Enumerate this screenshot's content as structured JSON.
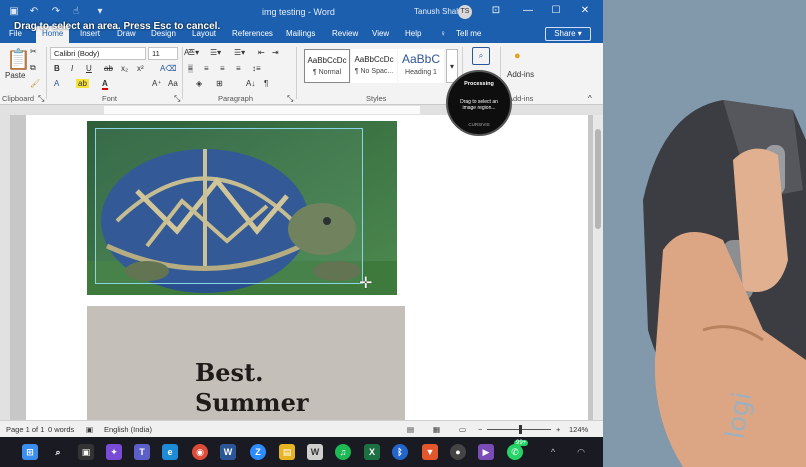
{
  "window": {
    "title": "img testing - Word",
    "user_name": "Tanush Shah",
    "avatar_initials": "TS",
    "drag_instruction": "Drag to select an area. Press Esc to cancel."
  },
  "menu": {
    "items": [
      {
        "id": "file",
        "label": "File"
      },
      {
        "id": "home",
        "label": "Home"
      },
      {
        "id": "insert",
        "label": "Insert"
      },
      {
        "id": "draw",
        "label": "Draw"
      },
      {
        "id": "design",
        "label": "Design"
      },
      {
        "id": "layout",
        "label": "Layout"
      },
      {
        "id": "references",
        "label": "References"
      },
      {
        "id": "mailings",
        "label": "Mailings"
      },
      {
        "id": "review",
        "label": "Review"
      },
      {
        "id": "view",
        "label": "View"
      },
      {
        "id": "help",
        "label": "Help"
      },
      {
        "id": "tellme",
        "label": "Tell me"
      }
    ],
    "share_label": "Share"
  },
  "ribbon": {
    "paste_label": "Paste",
    "font_name": "Calibri (Body)",
    "font_size": "11",
    "bold": "B",
    "italic": "I",
    "underline": "U",
    "strike": "ab",
    "subscript": "x₂",
    "superscript": "x²",
    "groups": {
      "clipboard": "Clipboard",
      "font": "Font",
      "paragraph": "Paragraph",
      "styles": "Styles",
      "addins": "Add-ins"
    },
    "styles": [
      {
        "sample": "AaBbCcDc",
        "name": "¶ Normal"
      },
      {
        "sample": "AaBbCcDc",
        "name": "¶ No Spac..."
      },
      {
        "sample": "AaBbC",
        "name": "Heading 1"
      }
    ],
    "addins_label": "Add-ins"
  },
  "processing": {
    "title": "Processing",
    "message": "Drag to select an image region...",
    "brand": "CURSIVIS"
  },
  "document": {
    "paper_lines": [
      "Best.",
      "Summer"
    ]
  },
  "status": {
    "page": "Page 1 of 1",
    "words": "0 words",
    "language": "English (India)",
    "zoom_minus": "−",
    "zoom_plus": "+",
    "zoom": "124%"
  },
  "taskbar": {
    "apps": [
      {
        "id": "start",
        "glyph": "⊞",
        "color": "#3b8df0"
      },
      {
        "id": "search",
        "glyph": "○",
        "color": "#1a1b22"
      },
      {
        "id": "taskview",
        "glyph": "▣",
        "color": "#1a1b22"
      },
      {
        "id": "copilot",
        "glyph": "✦",
        "color": "#7a4bd6"
      },
      {
        "id": "teams",
        "glyph": "T",
        "color": "#5b5fc7"
      },
      {
        "id": "edge",
        "glyph": "e",
        "color": "#1e8bd6"
      },
      {
        "id": "chrome",
        "glyph": "◉",
        "color": "#dd4b39"
      },
      {
        "id": "word",
        "glyph": "W",
        "color": "#2b5797"
      },
      {
        "id": "zoom",
        "glyph": "Z",
        "color": "#2d8cff"
      },
      {
        "id": "explorer",
        "glyph": "▤",
        "color": "#e6b422"
      },
      {
        "id": "wordpad",
        "glyph": "W",
        "color": "#cfcfcf"
      },
      {
        "id": "spotify",
        "glyph": "♫",
        "color": "#1db954"
      },
      {
        "id": "excel",
        "glyph": "X",
        "color": "#1d7044"
      },
      {
        "id": "bluetooth",
        "glyph": "ᛒ",
        "color": "#2266cc"
      },
      {
        "id": "brave",
        "glyph": "▼",
        "color": "#e2572b"
      },
      {
        "id": "obs",
        "glyph": "●",
        "color": "#444"
      },
      {
        "id": "media",
        "glyph": "▶",
        "color": "#7b4bb7"
      },
      {
        "id": "whatsapp",
        "glyph": "✆",
        "color": "#25d366"
      }
    ],
    "badge": "99+"
  }
}
